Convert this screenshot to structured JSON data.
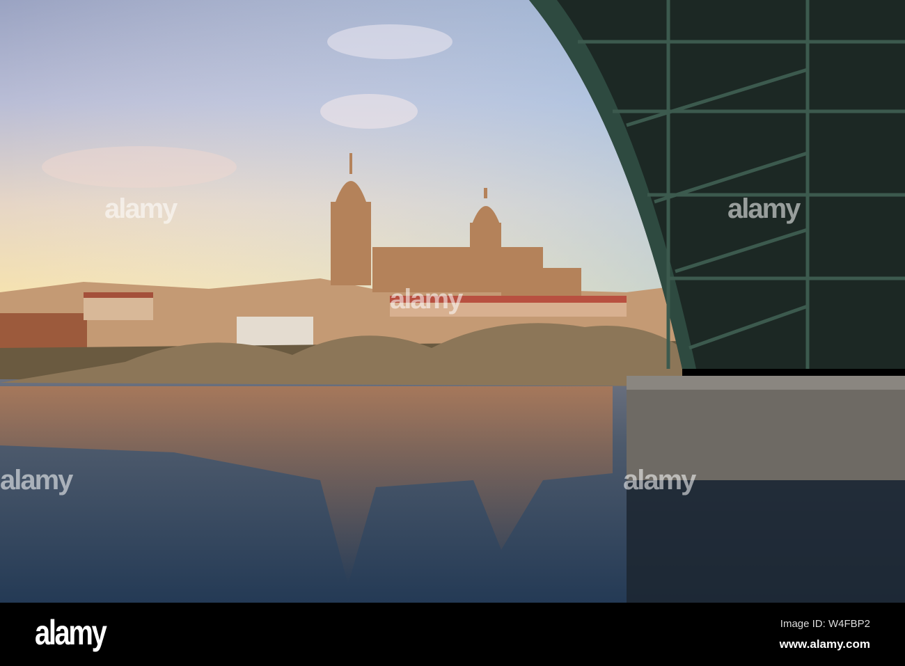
{
  "photo": {
    "subject": "Salamanca Cathedral across Tormes River under bridge"
  },
  "watermark": {
    "text": "alamy"
  },
  "footer": {
    "logo": "alamy",
    "image_id": "Image ID: W4FBP2",
    "url": "www.alamy.com"
  },
  "colors": {
    "sky_top": "#9fa8c4",
    "sky_horizon": "#f3e0b4",
    "water": "#2f4660",
    "bridge": "#1d2a26"
  }
}
